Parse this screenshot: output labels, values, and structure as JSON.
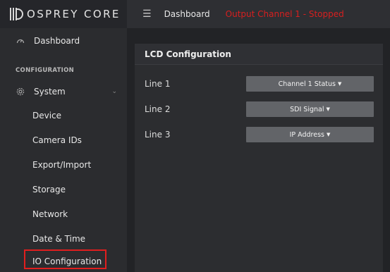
{
  "logo": {
    "text": "OSPREY CORE"
  },
  "sidebar": {
    "dashboard_label": "Dashboard",
    "section_label": "CONFIGURATION",
    "system_label": "System",
    "sub_items": [
      "Device",
      "Camera IDs",
      "Export/Import",
      "Storage",
      "Network",
      "Date & Time",
      "IO Configuration"
    ]
  },
  "header": {
    "title": "Dashboard",
    "status": "Output Channel 1 - Stopped",
    "status_color": "#d81f1f"
  },
  "panel": {
    "title": "LCD Configuration",
    "rows": [
      {
        "label": "Line 1",
        "value": "Channel 1 Status"
      },
      {
        "label": "Line 2",
        "value": "SDI Signal"
      },
      {
        "label": "Line 3",
        "value": "IP Address"
      }
    ]
  },
  "highlight_color": "#e01e1e"
}
